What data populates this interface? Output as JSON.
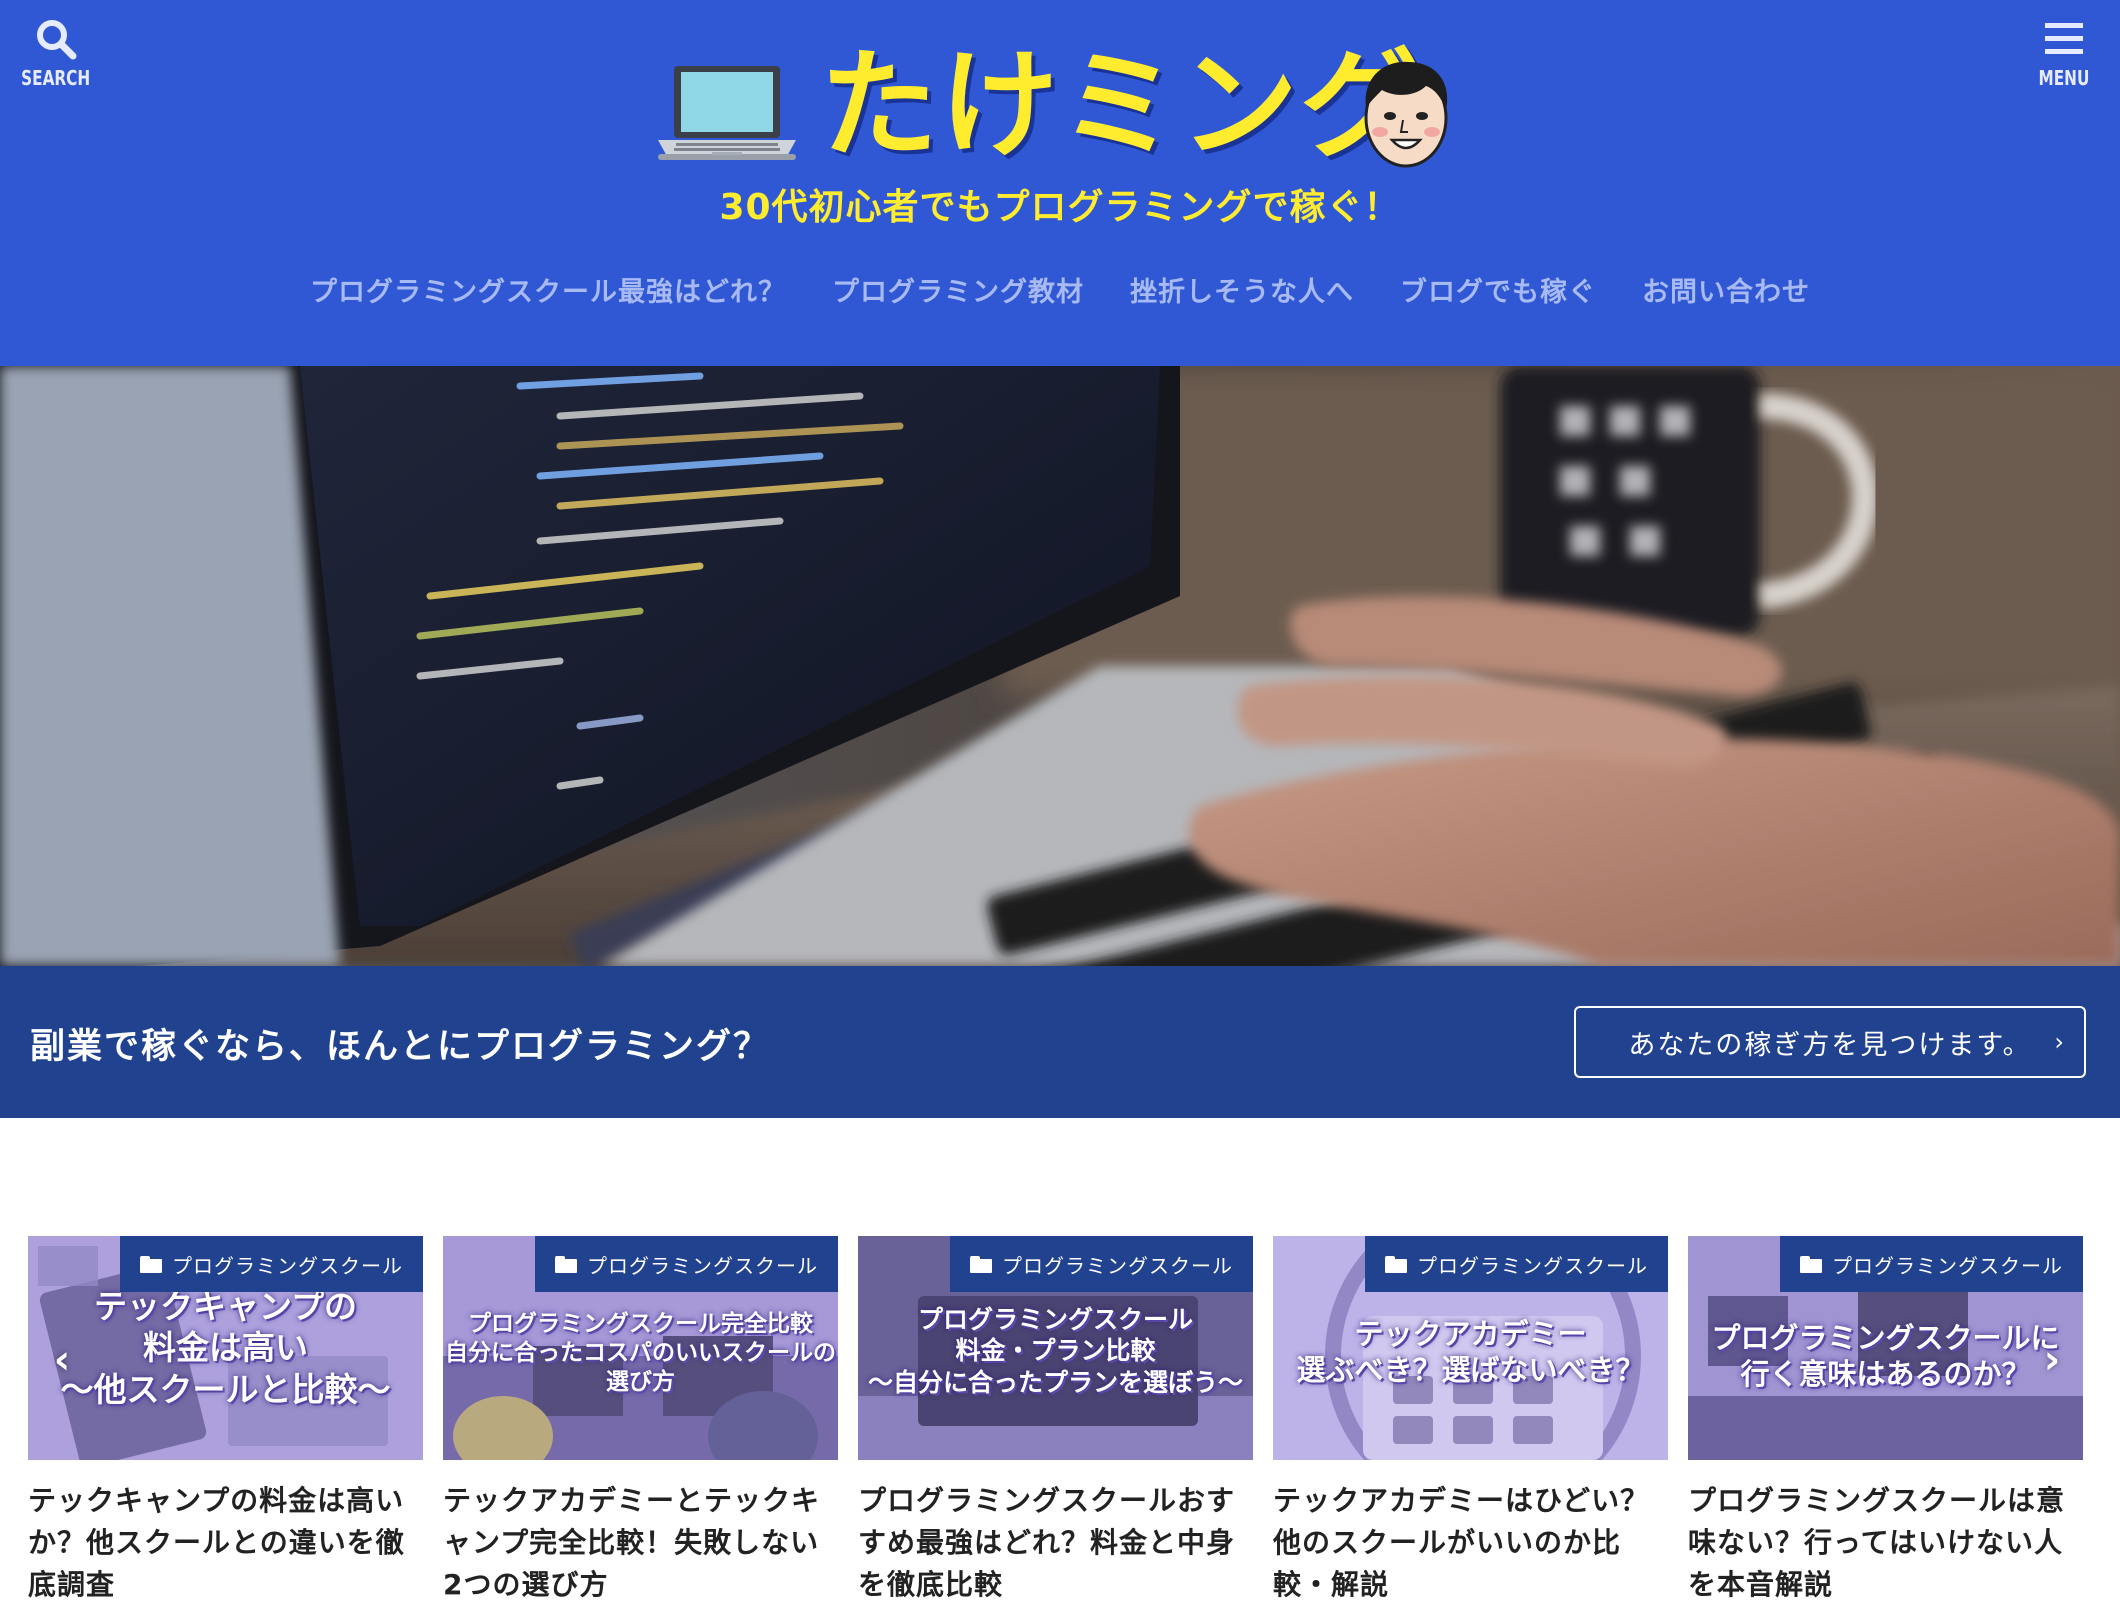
{
  "header": {
    "search_label": "SEARCH",
    "menu_label": "MENU",
    "site_title": "たけミング",
    "tagline": "30代初心者でもプログラミングで稼ぐ！",
    "nav": [
      {
        "label": "プログラミングスクール最強はどれ？"
      },
      {
        "label": "プログラミング教材"
      },
      {
        "label": "挫折しそうな人へ"
      },
      {
        "label": "ブログでも稼ぐ"
      },
      {
        "label": "お問い合わせ"
      }
    ]
  },
  "cta": {
    "text": "副業で稼ぐなら、ほんとにプログラミング？",
    "button_label": "あなたの稼ぎ方を見つけます。",
    "button_chevron": "›"
  },
  "cards": [
    {
      "category": "プログラミングスクール",
      "thumb_lines": [
        "テックキャンプの",
        "料金は高い",
        "〜他スクールと比較〜"
      ],
      "title": "テックキャンプの料金は高いか？他スクールとの違いを徹底調査"
    },
    {
      "category": "プログラミングスクール",
      "thumb_lines": [
        "プログラミングスクール完全比較",
        "自分に合ったコスパのいいスクールの",
        "選び方"
      ],
      "title": "テックアカデミーとテックキャンプ完全比較！失敗しない2つの選び方"
    },
    {
      "category": "プログラミングスクール",
      "thumb_lines": [
        "プログラミングスクール",
        "料金・プラン比較",
        "〜自分に合ったプランを選ぼう〜"
      ],
      "title": "プログラミングスクールおすすめ最強はどれ？料金と中身を徹底比較"
    },
    {
      "category": "プログラミングスクール",
      "thumb_lines": [
        "テックアカデミー",
        "選ぶべき？選ばないべき？"
      ],
      "title": "テックアカデミーはひどい？他のスクールがいいのか比較・解説"
    },
    {
      "category": "プログラミングスクール",
      "thumb_lines": [
        "プログラミングスクールに",
        "行く意味はあるのか？"
      ],
      "title": "プログラミングスクールは意味ない？行ってはいけない人を本音解説"
    }
  ],
  "carousel": {
    "prev": "‹",
    "next": "›"
  },
  "colors": {
    "header_bg": "#3058d4",
    "accent_yellow": "#ffec2e",
    "nav_text": "#a8baf3",
    "band_bg": "#21428f"
  },
  "icons": [
    "search-icon",
    "hamburger-menu-icon",
    "laptop-icon",
    "avatar-face-icon",
    "folder-icon",
    "chevron-right-icon",
    "chevron-left-icon"
  ]
}
